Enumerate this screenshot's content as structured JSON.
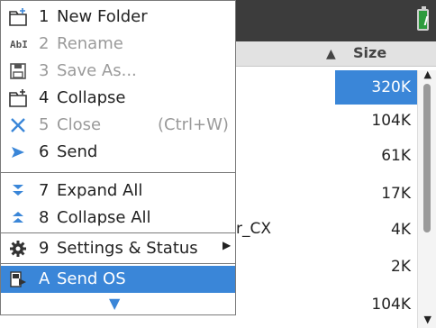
{
  "menu": {
    "items": [
      {
        "key": "1",
        "label": "New Folder",
        "icon": "new-folder-icon"
      },
      {
        "key": "2",
        "label": "Rename",
        "icon": "rename-icon"
      },
      {
        "key": "3",
        "label": "Save As...",
        "icon": "save-as-icon"
      },
      {
        "key": "4",
        "label": "Collapse",
        "icon": "collapse-folder-icon"
      },
      {
        "key": "5",
        "label": "Close",
        "shortcut": "(Ctrl+W)",
        "icon": "close-icon"
      },
      {
        "key": "6",
        "label": "Send",
        "icon": "send-icon"
      },
      {
        "key": "7",
        "label": "Expand All",
        "icon": "expand-all-icon"
      },
      {
        "key": "8",
        "label": "Collapse All",
        "icon": "collapse-all-icon"
      },
      {
        "key": "9",
        "label": "Settings & Status",
        "icon": "gear-icon"
      },
      {
        "key": "A",
        "label": "Send OS",
        "icon": "send-os-icon"
      }
    ]
  },
  "file_list": {
    "size_header": "Size",
    "sizes": [
      "320K",
      "104K",
      "61K",
      "17K",
      "4K",
      "2K",
      "104K"
    ],
    "partial_name": "r_CX"
  },
  "colors": {
    "accent": "#3a86d8",
    "titlebar": "#3c3c3c",
    "battery": "#2e9b3e"
  }
}
